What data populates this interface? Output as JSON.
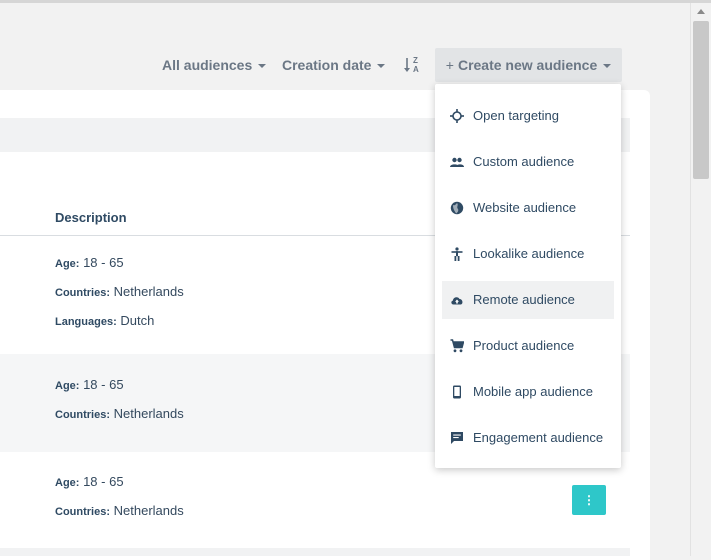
{
  "toolbar": {
    "all_audiences": "All audiences",
    "creation_date": "Creation date",
    "sort_top": "Z",
    "sort_bottom": "A",
    "create_plus": "+",
    "create_label": "Create new audience"
  },
  "table": {
    "description_header": "Description",
    "rows": [
      {
        "age_key": "Age:",
        "age_val": "18 - 65",
        "countries_key": "Countries:",
        "countries_val": "Netherlands",
        "languages_key": "Languages:",
        "languages_val": "Dutch"
      },
      {
        "age_key": "Age:",
        "age_val": "18 - 65",
        "countries_key": "Countries:",
        "countries_val": "Netherlands"
      },
      {
        "age_key": "Age:",
        "age_val": "18 - 65",
        "countries_key": "Countries:",
        "countries_val": "Netherlands"
      }
    ]
  },
  "row_actions_glyph": "⋮",
  "menu": {
    "items": [
      {
        "label": "Open targeting",
        "icon": "crosshair-icon"
      },
      {
        "label": "Custom audience",
        "icon": "people-icon"
      },
      {
        "label": "Website audience",
        "icon": "globe-icon"
      },
      {
        "label": "Lookalike audience",
        "icon": "accessibility-icon"
      },
      {
        "label": "Remote audience",
        "icon": "cloud-upload-icon"
      },
      {
        "label": "Product audience",
        "icon": "cart-icon"
      },
      {
        "label": "Mobile app audience",
        "icon": "phone-icon"
      },
      {
        "label": "Engagement audience",
        "icon": "comment-icon"
      }
    ],
    "highlighted_index": 4
  },
  "colors": {
    "accent": "#2ec7c9",
    "text": "#2f4a63",
    "toolbar_text": "#6b7785"
  }
}
